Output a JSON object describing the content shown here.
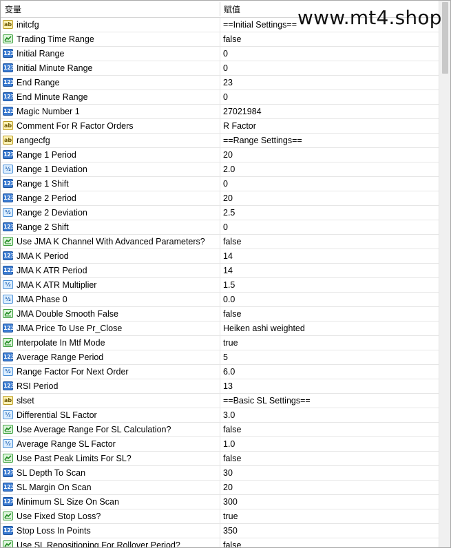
{
  "header": {
    "col_variable": "变量",
    "col_value": "赋值"
  },
  "watermark": "www.mt4.shop",
  "icons": {
    "ab": "ab",
    "num": "123",
    "dbl": "½"
  },
  "rows": [
    {
      "type": "string",
      "name": "initcfg",
      "value": "==Initial Settings=="
    },
    {
      "type": "bool",
      "name": "Trading Time Range",
      "value": "false"
    },
    {
      "type": "int",
      "name": "Initial Range",
      "value": "0"
    },
    {
      "type": "int",
      "name": "Initial Minute Range",
      "value": "0"
    },
    {
      "type": "int",
      "name": "End Range",
      "value": "23"
    },
    {
      "type": "int",
      "name": "End Minute Range",
      "value": "0"
    },
    {
      "type": "int",
      "name": "Magic Number 1",
      "value": "27021984"
    },
    {
      "type": "string",
      "name": "Comment For R Factor Orders",
      "value": "R Factor"
    },
    {
      "type": "string",
      "name": "rangecfg",
      "value": "==Range Settings=="
    },
    {
      "type": "int",
      "name": "Range 1 Period",
      "value": "20"
    },
    {
      "type": "double",
      "name": "Range 1 Deviation",
      "value": "2.0"
    },
    {
      "type": "int",
      "name": "Range 1 Shift",
      "value": "0"
    },
    {
      "type": "int",
      "name": "Range 2 Period",
      "value": "20"
    },
    {
      "type": "double",
      "name": "Range 2 Deviation",
      "value": "2.5"
    },
    {
      "type": "int",
      "name": "Range 2 Shift",
      "value": "0"
    },
    {
      "type": "bool",
      "name": "Use JMA K Channel With Advanced Parameters?",
      "value": "false"
    },
    {
      "type": "int",
      "name": "JMA K Period",
      "value": "14"
    },
    {
      "type": "int",
      "name": "JMA K ATR Period",
      "value": "14"
    },
    {
      "type": "double",
      "name": "JMA K ATR Multiplier",
      "value": "1.5"
    },
    {
      "type": "double",
      "name": "JMA Phase 0",
      "value": "0.0"
    },
    {
      "type": "bool",
      "name": "JMA Double Smooth False",
      "value": "false"
    },
    {
      "type": "int",
      "name": "JMA Price To Use Pr_Close",
      "value": "Heiken ashi weighted"
    },
    {
      "type": "bool",
      "name": "Interpolate In Mtf Mode",
      "value": "true"
    },
    {
      "type": "int",
      "name": "Average Range Period",
      "value": "5"
    },
    {
      "type": "double",
      "name": "Range Factor For Next Order",
      "value": "6.0"
    },
    {
      "type": "int",
      "name": "RSI Period",
      "value": "13"
    },
    {
      "type": "string",
      "name": "slset",
      "value": "==Basic SL Settings=="
    },
    {
      "type": "double",
      "name": "Differential SL Factor",
      "value": "3.0"
    },
    {
      "type": "bool",
      "name": "Use Average Range For SL Calculation?",
      "value": "false"
    },
    {
      "type": "double",
      "name": "Average Range SL Factor",
      "value": "1.0"
    },
    {
      "type": "bool",
      "name": "Use Past Peak Limits For SL?",
      "value": "false"
    },
    {
      "type": "int",
      "name": "SL Depth To Scan",
      "value": "30"
    },
    {
      "type": "int",
      "name": "SL Margin On Scan",
      "value": "20"
    },
    {
      "type": "int",
      "name": "Minimum SL Size On Scan",
      "value": "300"
    },
    {
      "type": "bool",
      "name": "Use Fixed Stop Loss?",
      "value": "true"
    },
    {
      "type": "int",
      "name": "Stop Loss In Points",
      "value": "350"
    },
    {
      "type": "bool",
      "name": "Use SL Repositioning For Rollover Period?",
      "value": "false"
    }
  ]
}
